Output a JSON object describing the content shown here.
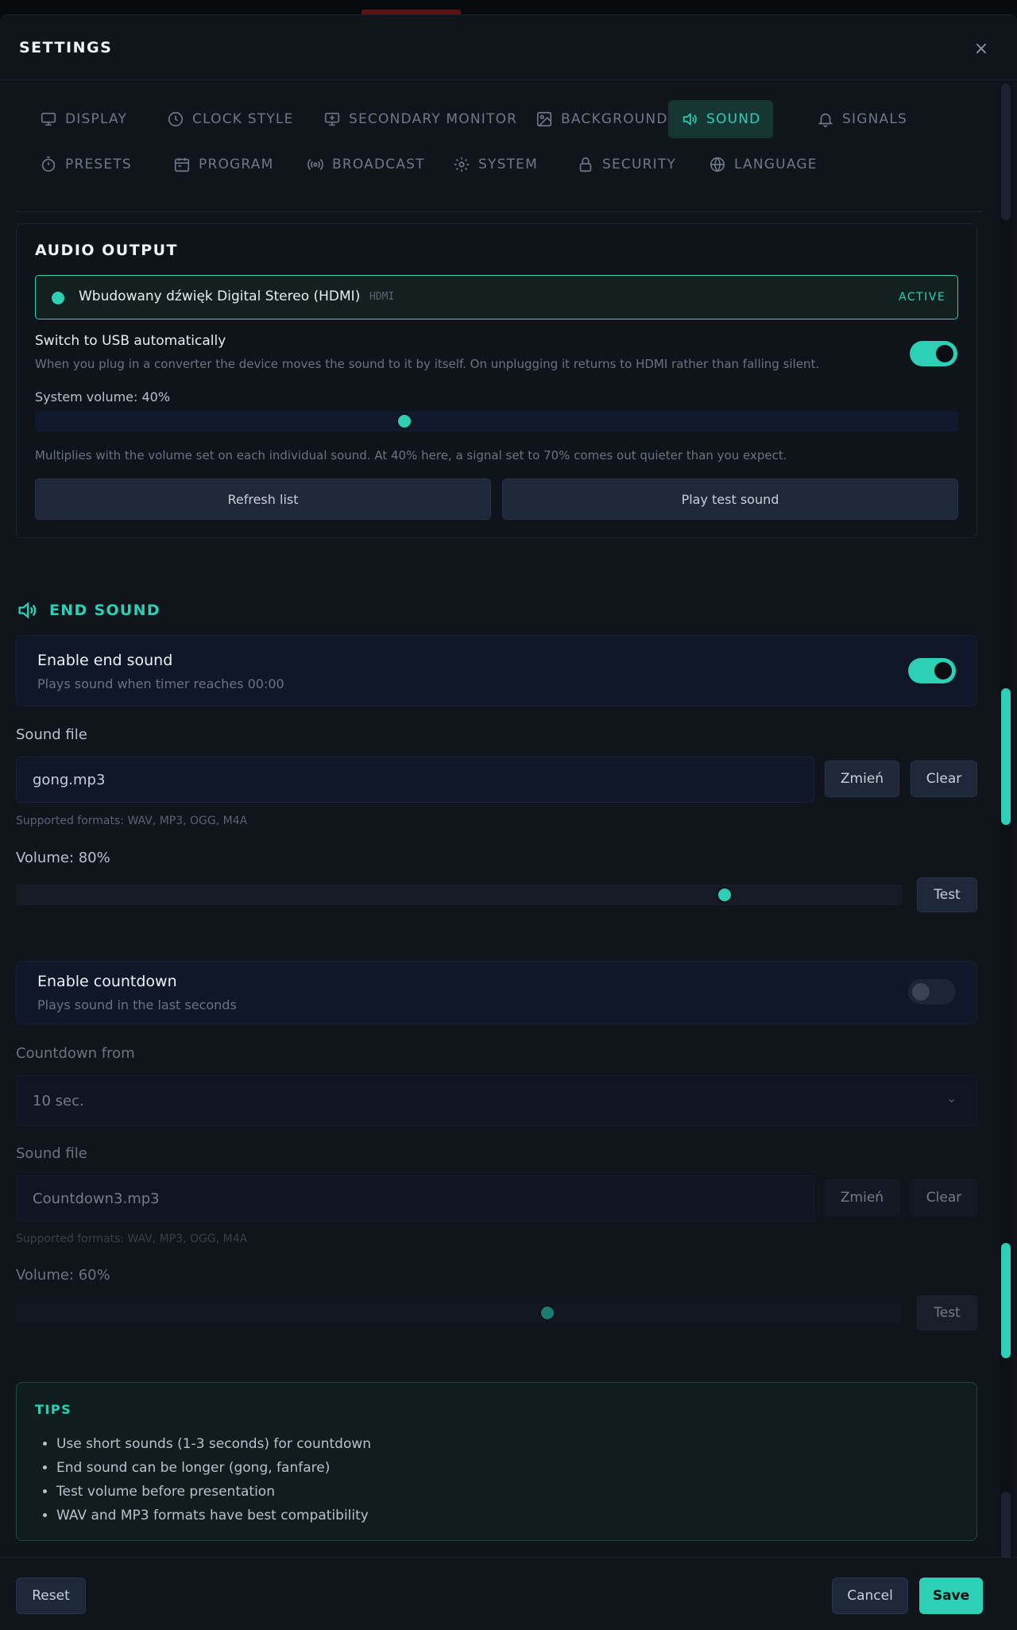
{
  "header": {
    "title": "SETTINGS",
    "close": "×"
  },
  "tabs": [
    {
      "label": "DISPLAY",
      "icon": "monitor-icon",
      "active": false
    },
    {
      "label": "CLOCK STYLE",
      "icon": "clock-icon",
      "active": false
    },
    {
      "label": "SECONDARY MONITOR",
      "icon": "monitor-plus-icon",
      "active": false
    },
    {
      "label": "BACKGROUND",
      "icon": "image-icon",
      "active": false
    },
    {
      "label": "SOUND",
      "icon": "speaker-icon",
      "active": true
    },
    {
      "label": "SIGNALS",
      "icon": "bell-icon",
      "active": false
    },
    {
      "label": "PRESETS",
      "icon": "timer-icon",
      "active": false
    },
    {
      "label": "PROGRAM",
      "icon": "calendar-icon",
      "active": false
    },
    {
      "label": "BROADCAST",
      "icon": "broadcast-icon",
      "active": false
    },
    {
      "label": "SYSTEM",
      "icon": "gear-icon",
      "active": false
    },
    {
      "label": "SECURITY",
      "icon": "lock-icon",
      "active": false
    },
    {
      "label": "LANGUAGE",
      "icon": "globe-icon",
      "active": false
    }
  ],
  "audio_output": {
    "title": "AUDIO OUTPUT",
    "device_name": "Wbudowany dźwięk Digital Stereo (HDMI)",
    "device_type": "HDMI",
    "device_status": "ACTIVE",
    "usb_title": "Switch to USB automatically",
    "usb_desc": "When you plug in a converter the device moves the sound to it by itself. On unplugging it returns to HDMI rather than falling silent.",
    "usb_enabled": true,
    "system_volume_label": "System volume: 40%",
    "system_volume": 40,
    "system_volume_hint": "Multiplies with the volume set on each individual sound. At 40% here, a signal set to 70% comes out quieter than you expect.",
    "refresh_label": "Refresh list",
    "test_label": "Play test sound"
  },
  "end_sound": {
    "section_title": "END SOUND",
    "enable_title": "Enable end sound",
    "enable_desc": "Plays sound when timer reaches 00:00",
    "enabled": true,
    "file_label": "Sound file",
    "file_value": "gong.mp3",
    "change_label": "Zmień",
    "clear_label": "Clear",
    "formats": "Supported formats: WAV, MP3, OGG, M4A",
    "volume_label": "Volume: 80%",
    "volume": 80,
    "test_label": "Test"
  },
  "countdown": {
    "enable_title": "Enable countdown",
    "enable_desc": "Plays sound in the last seconds",
    "enabled": false,
    "from_label": "Countdown from",
    "from_value": "10 sec.",
    "file_label": "Sound file",
    "file_value": "Countdown3.mp3",
    "change_label": "Zmień",
    "clear_label": "Clear",
    "formats": "Supported formats: WAV, MP3, OGG, M4A",
    "volume_label": "Volume: 60%",
    "volume": 60,
    "test_label": "Test"
  },
  "tips": {
    "title": "TIPS",
    "items": [
      "Use short sounds (1-3 seconds) for countdown",
      "End sound can be longer (gong, fanfare)",
      "Test volume before presentation",
      "WAV and MP3 formats have best compatibility"
    ]
  },
  "footer": {
    "reset_label": "Reset",
    "cancel_label": "Cancel",
    "save_label": "Save"
  },
  "colors": {
    "accent": "#2dcfb5",
    "background": "#10141b",
    "panel": "#0f1728"
  }
}
